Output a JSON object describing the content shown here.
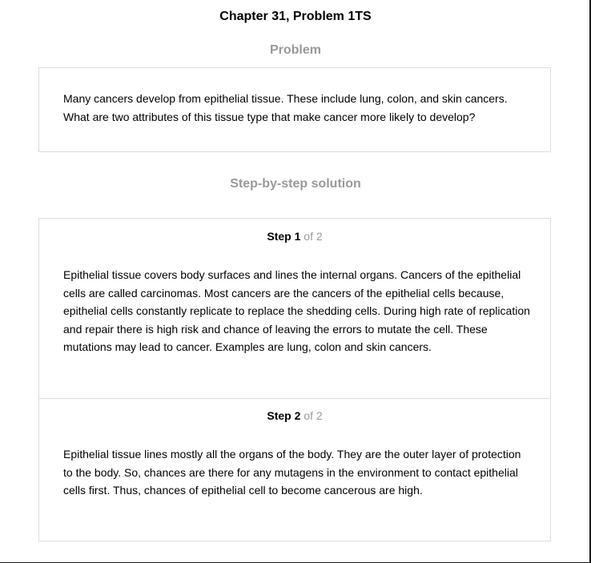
{
  "header": {
    "title": "Chapter 31, Problem 1TS"
  },
  "problem": {
    "heading": "Problem",
    "text": "Many cancers develop from epithelial tissue. These include lung, colon, and skin cancers. What are two attributes of this tissue type that make cancer more likely to develop?"
  },
  "solution": {
    "heading": "Step-by-step solution",
    "steps": [
      {
        "label": "Step",
        "number": "1",
        "of_text": "of 2",
        "text": "Epithelial tissue covers body surfaces and lines the internal organs. Cancers of the epithelial cells are called carcinomas. Most cancers are the cancers of the epithelial cells because, epithelial cells constantly replicate to replace the shedding cells. During high rate of replication and repair there is high risk and chance of leaving the errors to mutate the cell. These mutations may lead to cancer. Examples are lung, colon and skin cancers."
      },
      {
        "label": "Step",
        "number": "2",
        "of_text": "of 2",
        "text": "Epithelial tissue lines mostly all the organs of the body. They are the outer layer of protection to the body. So, chances are there for any mutagens in the environment to contact epithelial cells first. Thus, chances of epithelial cell to become cancerous are high."
      }
    ]
  }
}
